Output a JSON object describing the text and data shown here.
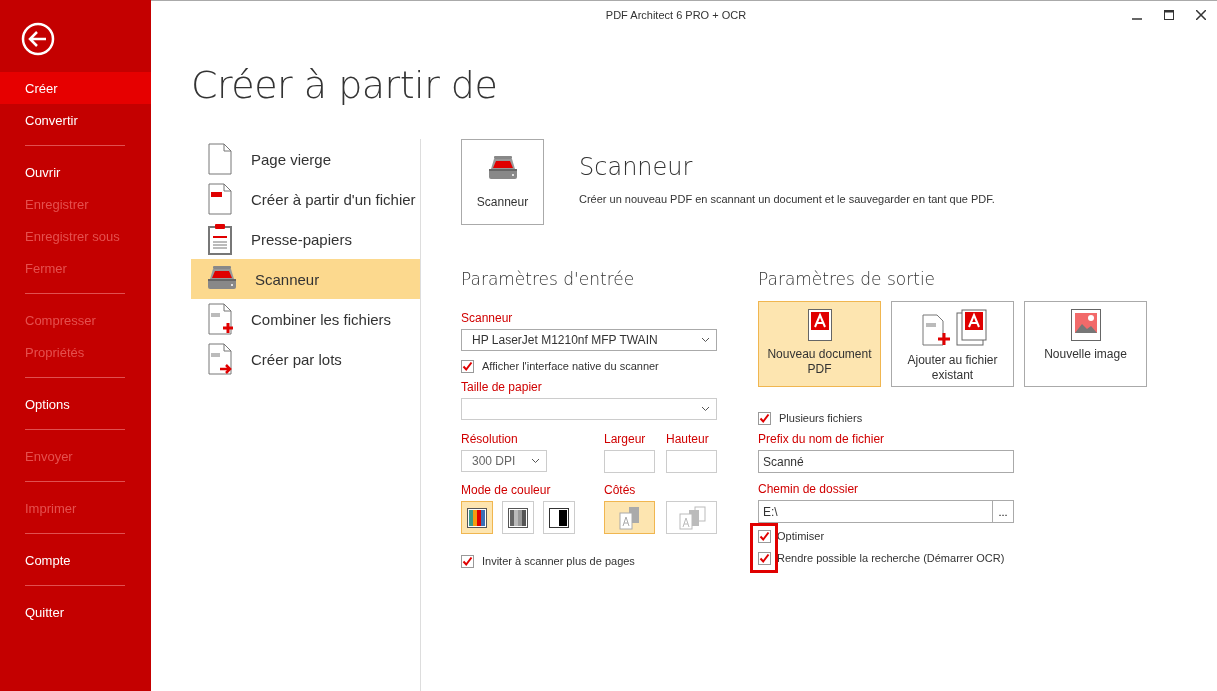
{
  "window": {
    "title": "PDF Architect 6 PRO + OCR"
  },
  "sidebar": {
    "groups": [
      {
        "items": [
          {
            "label": "Créer",
            "selected": true,
            "disabled": false
          },
          {
            "label": "Convertir",
            "selected": false,
            "disabled": false
          }
        ]
      },
      {
        "items": [
          {
            "label": "Ouvrir",
            "selected": false,
            "disabled": false
          },
          {
            "label": "Enregistrer",
            "selected": false,
            "disabled": true
          },
          {
            "label": "Enregistrer sous",
            "selected": false,
            "disabled": true
          },
          {
            "label": "Fermer",
            "selected": false,
            "disabled": true
          }
        ]
      },
      {
        "items": [
          {
            "label": "Compresser",
            "selected": false,
            "disabled": true
          },
          {
            "label": "Propriétés",
            "selected": false,
            "disabled": true
          }
        ]
      },
      {
        "items": [
          {
            "label": "Options",
            "selected": false,
            "disabled": false
          }
        ]
      },
      {
        "items": [
          {
            "label": "Envoyer",
            "selected": false,
            "disabled": true
          }
        ]
      },
      {
        "items": [
          {
            "label": "Imprimer",
            "selected": false,
            "disabled": true
          }
        ]
      },
      {
        "items": [
          {
            "label": "Compte",
            "selected": false,
            "disabled": false
          }
        ]
      },
      {
        "items": [
          {
            "label": "Quitter",
            "selected": false,
            "disabled": false
          }
        ]
      }
    ]
  },
  "page": {
    "title": "Créer à partir de"
  },
  "sources": [
    {
      "kind": "blank",
      "label": "Page vierge",
      "selected": false
    },
    {
      "kind": "file",
      "label": "Créer à partir d'un fichier",
      "selected": false
    },
    {
      "kind": "clipboard",
      "label": "Presse-papiers",
      "selected": false
    },
    {
      "kind": "scanner",
      "label": "Scanneur",
      "selected": true
    },
    {
      "kind": "combine",
      "label": "Combiner les fichiers",
      "selected": false
    },
    {
      "kind": "batch",
      "label": "Créer par lots",
      "selected": false
    }
  ],
  "detail": {
    "tile_label": "Scanneur",
    "title": "Scanneur",
    "description": "Créer un nouveau PDF en scannant un document et le sauvegarder en tant que PDF."
  },
  "input_settings": {
    "heading": "Paramètres d'entrée",
    "scanner": {
      "label": "Scanneur",
      "value": "HP LaserJet M1210nf MFP TWAIN"
    },
    "native_ui": {
      "label": "Afficher l'interface native du scanner",
      "checked": true
    },
    "paper_size": {
      "label": "Taille de papier"
    },
    "resolution": {
      "label": "Résolution",
      "value": "300 DPI"
    },
    "width": {
      "label": "Largeur"
    },
    "height": {
      "label": "Hauteur"
    },
    "color_mode": {
      "label": "Mode de couleur",
      "options": [
        {
          "kind": "color",
          "selected": true
        },
        {
          "kind": "gray",
          "selected": false
        },
        {
          "kind": "bw",
          "selected": false
        }
      ]
    },
    "sides": {
      "label": "Côtés",
      "options": [
        {
          "kind": "single",
          "selected": true
        },
        {
          "kind": "double",
          "selected": false
        }
      ]
    },
    "more_pages": {
      "label": "Inviter à scanner plus de pages",
      "checked": true
    }
  },
  "output_settings": {
    "heading": "Paramètres de sortie",
    "targets": [
      {
        "kind": "new_pdf",
        "label": "Nouveau document PDF",
        "selected": true
      },
      {
        "kind": "append",
        "label": "Ajouter au fichier existant",
        "selected": false
      },
      {
        "kind": "image",
        "label": "Nouvelle image",
        "selected": false
      }
    ],
    "multiple_files": {
      "label": "Plusieurs fichiers",
      "checked": true
    },
    "prefix": {
      "label": "Prefix du nom de fichier",
      "value": "Scanné"
    },
    "folder": {
      "label": "Chemin de dossier",
      "value": "E:\\",
      "browse": "..."
    },
    "options": [
      {
        "label": "Optimiser",
        "checked": true,
        "highlighted": true
      },
      {
        "label": "Rendre possible la recherche (Démarrer OCR)",
        "checked": true,
        "highlighted": true
      }
    ]
  }
}
